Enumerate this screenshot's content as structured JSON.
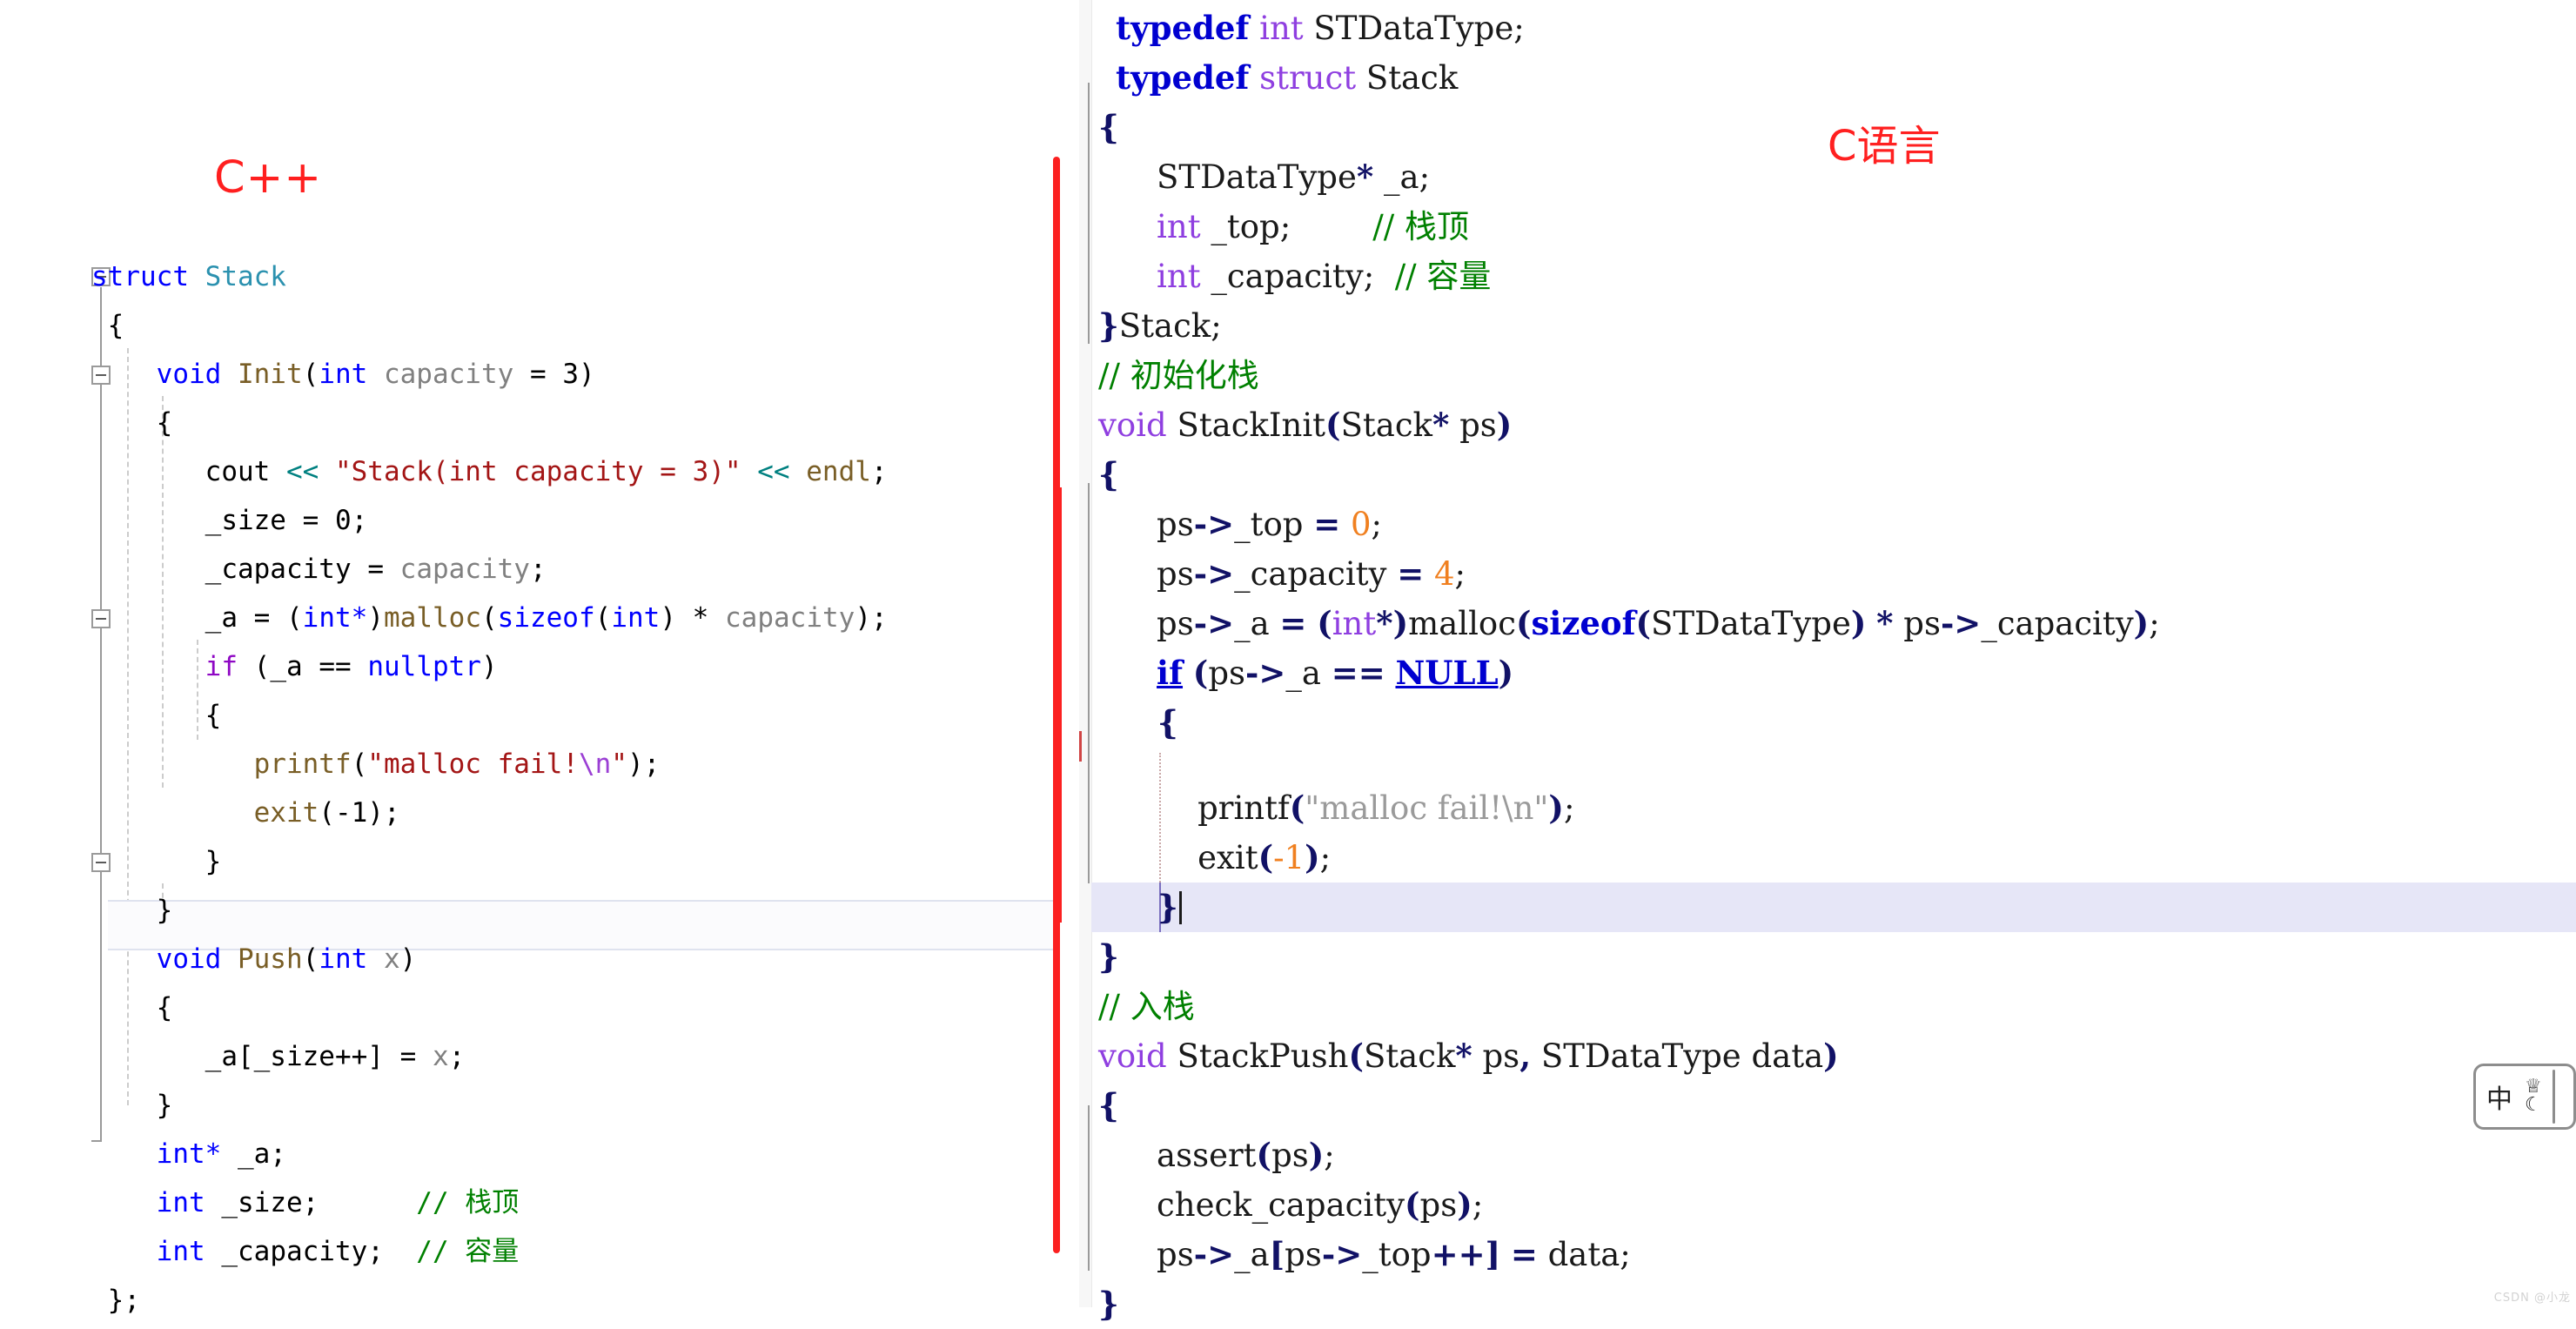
{
  "labels": {
    "cpp": "C++",
    "c": "C语言"
  },
  "watermark": "CSDN @小龙",
  "ime": {
    "mode": "中",
    "shirt_icon": "shirt-icon",
    "moon_icon": "moon-icon"
  },
  "left_pane": {
    "language": "C++",
    "lines": [
      "struct Stack",
      "{",
      "    void Init(int capacity = 3)",
      "    {",
      "        cout << \"Stack(int capacity = 3)\" << endl;",
      "        _size = 0;",
      "        _capacity = capacity;",
      "        _a = (int*)malloc(sizeof(int) * capacity);",
      "        if (_a == nullptr)",
      "        {",
      "            printf(\"malloc fail!\\n\");",
      "            exit(-1);",
      "        }",
      "    }",
      "    void Push(int x)",
      "    {",
      "        _a[_size++] = x;",
      "    }",
      "    int* _a;",
      "    int _size;       // 栈顶",
      "    int _capacity;  // 容量",
      "};"
    ],
    "highlighted_line": "_a[_size++] = x;",
    "comments": {
      "top": "// 栈顶",
      "capacity": "// 容量"
    }
  },
  "right_pane": {
    "language": "C",
    "lines": [
      "typedef int STDataType;",
      "typedef struct Stack",
      "{",
      "    STDataType* _a;",
      "    int _top;        // 栈顶",
      "    int _capacity;  // 容量",
      "}Stack;",
      "// 初始化栈",
      "void StackInit(Stack* ps)",
      "{",
      "    ps->_top = 0;",
      "    ps->_capacity = 4;",
      "    ps->_a = (int*)malloc(sizeof(STDataType) * ps->_capacity);",
      "    if (ps->_a == NULL)",
      "    {",
      "        printf(\"malloc fail!\\n\");",
      "        exit(-1);",
      "    }",
      "}",
      "// 入栈",
      "void StackPush(Stack* ps, STDataType data)",
      "{",
      "    assert(ps);",
      "    check_capacity(ps);",
      "    ps->_a[ps->_top++] = data;",
      "}"
    ],
    "highlighted_line": "    }",
    "comments": {
      "init_stack": "// 初始化栈",
      "push_stack": "// 入栈",
      "top": "// 栈顶",
      "capacity": "// 容量"
    },
    "values": {
      "top_init": "0",
      "capacity_init": "4",
      "exit_code": "-1"
    }
  },
  "colors": {
    "divider_red": "#fb2020",
    "label_red": "#ff2020",
    "comment_green": "#008000",
    "string_left": "#a31515",
    "string_right": "#9a9a9a",
    "keyword_left": "#0000ff",
    "keyword_right": "#0000d0",
    "type_right": "#8f3fe0",
    "number_right": "#f08020",
    "highlight_right": "#e6e6f7"
  }
}
